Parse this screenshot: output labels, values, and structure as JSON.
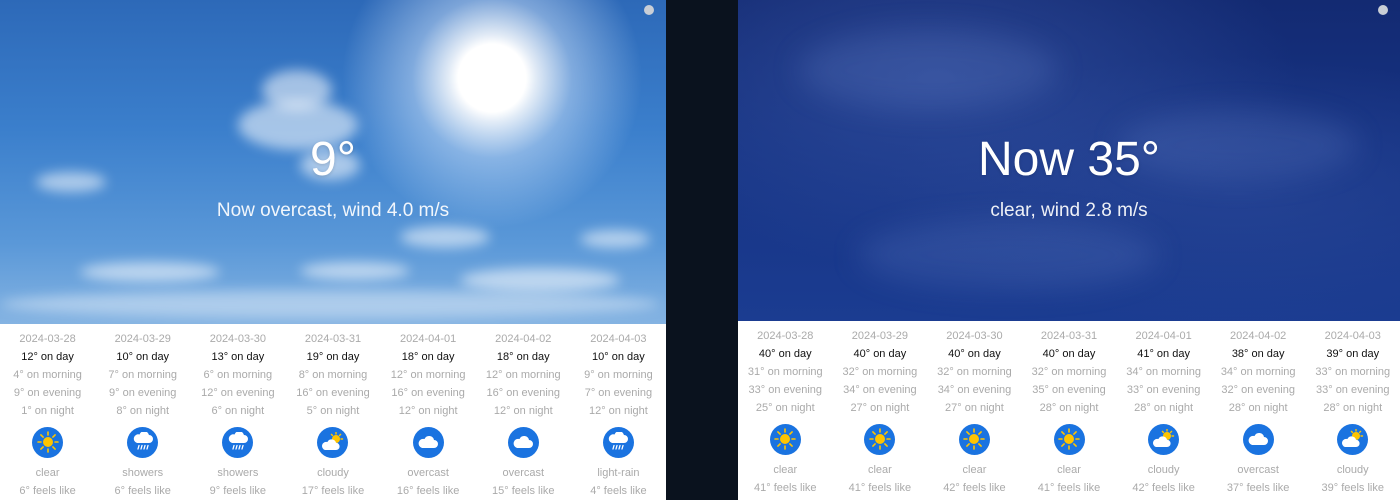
{
  "left": {
    "current": {
      "temp": "9°",
      "desc": "Now overcast, wind 4.0 m/s"
    },
    "days": [
      {
        "date": "2024-03-28",
        "day": "12° on day",
        "morning": "4° on morning",
        "evening": "9° on evening",
        "night": "1° on night",
        "icon": "sun-icon",
        "cond": "clear",
        "feels": "6° feels like"
      },
      {
        "date": "2024-03-29",
        "day": "10° on day",
        "morning": "7° on morning",
        "evening": "9° on evening",
        "night": "8° on night",
        "icon": "rain-cloud-icon",
        "cond": "showers",
        "feels": "6° feels like"
      },
      {
        "date": "2024-03-30",
        "day": "13° on day",
        "morning": "6° on morning",
        "evening": "12° on evening",
        "night": "6° on night",
        "icon": "rain-cloud-icon",
        "cond": "showers",
        "feels": "9° feels like"
      },
      {
        "date": "2024-03-31",
        "day": "19° on day",
        "morning": "8° on morning",
        "evening": "16° on evening",
        "night": "5° on night",
        "icon": "sun-cloud-icon",
        "cond": "cloudy",
        "feels": "17° feels like"
      },
      {
        "date": "2024-04-01",
        "day": "18° on day",
        "morning": "12° on morning",
        "evening": "16° on evening",
        "night": "12° on night",
        "icon": "cloud-icon",
        "cond": "overcast",
        "feels": "16° feels like"
      },
      {
        "date": "2024-04-02",
        "day": "18° on day",
        "morning": "12° on morning",
        "evening": "16° on evening",
        "night": "12° on night",
        "icon": "cloud-icon",
        "cond": "overcast",
        "feels": "15° feels like"
      },
      {
        "date": "2024-04-03",
        "day": "10° on day",
        "morning": "9° on morning",
        "evening": "7° on evening",
        "night": "12° on night",
        "icon": "rain-cloud-icon",
        "cond": "light-rain",
        "feels": "4° feels like"
      }
    ]
  },
  "right": {
    "current": {
      "temp": "Now 35°",
      "desc": "clear, wind 2.8 m/s"
    },
    "days": [
      {
        "date": "2024-03-28",
        "day": "40° on day",
        "morning": "31° on morning",
        "evening": "33° on evening",
        "night": "25° on night",
        "icon": "sun-icon",
        "cond": "clear",
        "feels": "41° feels like"
      },
      {
        "date": "2024-03-29",
        "day": "40° on day",
        "morning": "32° on morning",
        "evening": "34° on evening",
        "night": "27° on night",
        "icon": "sun-icon",
        "cond": "clear",
        "feels": "41° feels like"
      },
      {
        "date": "2024-03-30",
        "day": "40° on day",
        "morning": "32° on morning",
        "evening": "34° on evening",
        "night": "27° on night",
        "icon": "sun-icon",
        "cond": "clear",
        "feels": "42° feels like"
      },
      {
        "date": "2024-03-31",
        "day": "40° on day",
        "morning": "32° on morning",
        "evening": "35° on evening",
        "night": "28° on night",
        "icon": "sun-icon",
        "cond": "clear",
        "feels": "41° feels like"
      },
      {
        "date": "2024-04-01",
        "day": "41° on day",
        "morning": "34° on morning",
        "evening": "33° on evening",
        "night": "28° on night",
        "icon": "sun-cloud-icon",
        "cond": "cloudy",
        "feels": "42° feels like"
      },
      {
        "date": "2024-04-02",
        "day": "38° on day",
        "morning": "34° on morning",
        "evening": "32° on evening",
        "night": "28° on night",
        "icon": "cloud-icon",
        "cond": "overcast",
        "feels": "37° feels like"
      },
      {
        "date": "2024-04-03",
        "day": "39° on day",
        "morning": "33° on morning",
        "evening": "33° on evening",
        "night": "28° on night",
        "icon": "sun-cloud-icon",
        "cond": "cloudy",
        "feels": "39° feels like"
      }
    ]
  },
  "colors": {
    "icon_bg": "#1a73e0",
    "sun": "#ffc400",
    "accent_text": "#111111",
    "muted_text": "#aaaaaa"
  }
}
